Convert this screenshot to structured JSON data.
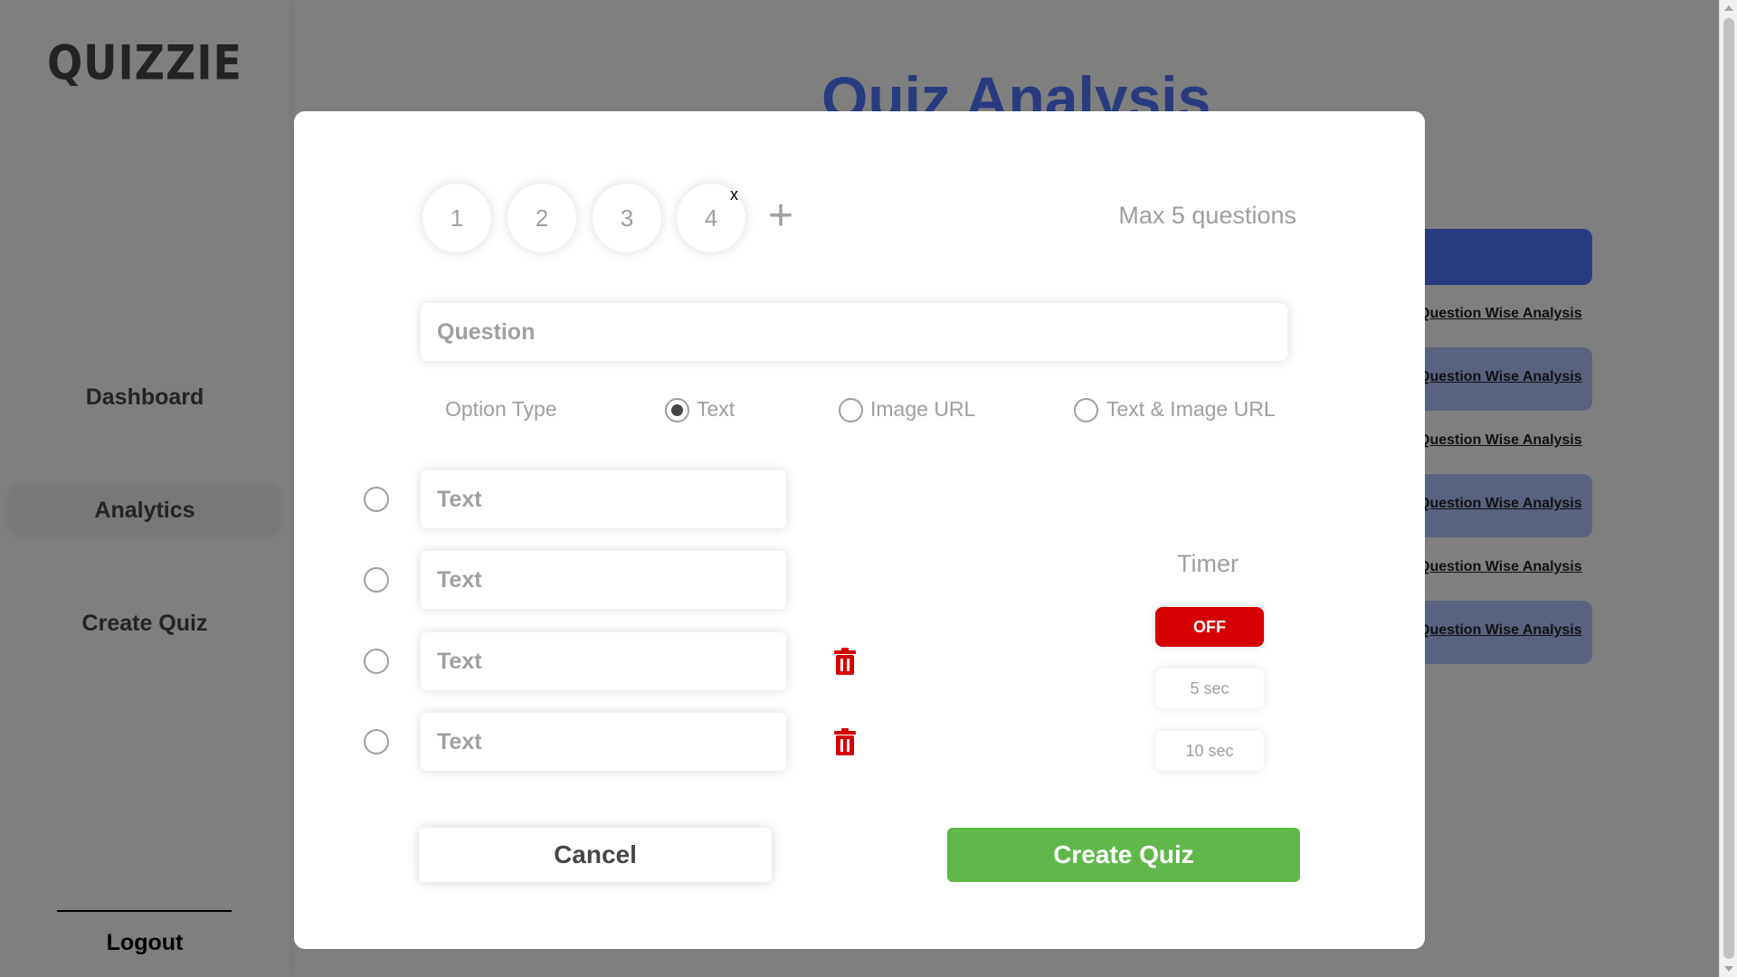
{
  "app": {
    "logo": "QUIZZIE"
  },
  "sidebar": {
    "items": [
      {
        "label": "Dashboard"
      },
      {
        "label": "Analytics"
      },
      {
        "label": "Create Quiz"
      }
    ],
    "logout_label": "Logout"
  },
  "main": {
    "title": "Quiz Analysis",
    "row_link_label": "Question Wise Analysis"
  },
  "modal": {
    "question_tabs": [
      "1",
      "2",
      "3",
      "4"
    ],
    "remove_question_label": "x",
    "add_question_label": "+",
    "max_questions_label": "Max 5 questions",
    "question_placeholder": "Question",
    "option_type": {
      "label": "Option Type",
      "choices": [
        "Text",
        "Image URL",
        "Text & Image URL"
      ],
      "selected": "Text"
    },
    "option_placeholder": "Text",
    "option_count": 4,
    "timer": {
      "label": "Timer",
      "options": [
        "OFF",
        "5 sec",
        "10 sec"
      ],
      "selected": "OFF"
    },
    "cancel_label": "Cancel",
    "create_label": "Create Quiz"
  },
  "colors": {
    "accent_blue": "#5076ff",
    "timer_active": "#d60000",
    "create_button": "#60b84b",
    "muted_text": "#9f9f9f"
  },
  "icons": {
    "option_delete": "trash-icon",
    "add_question": "plus-icon"
  }
}
